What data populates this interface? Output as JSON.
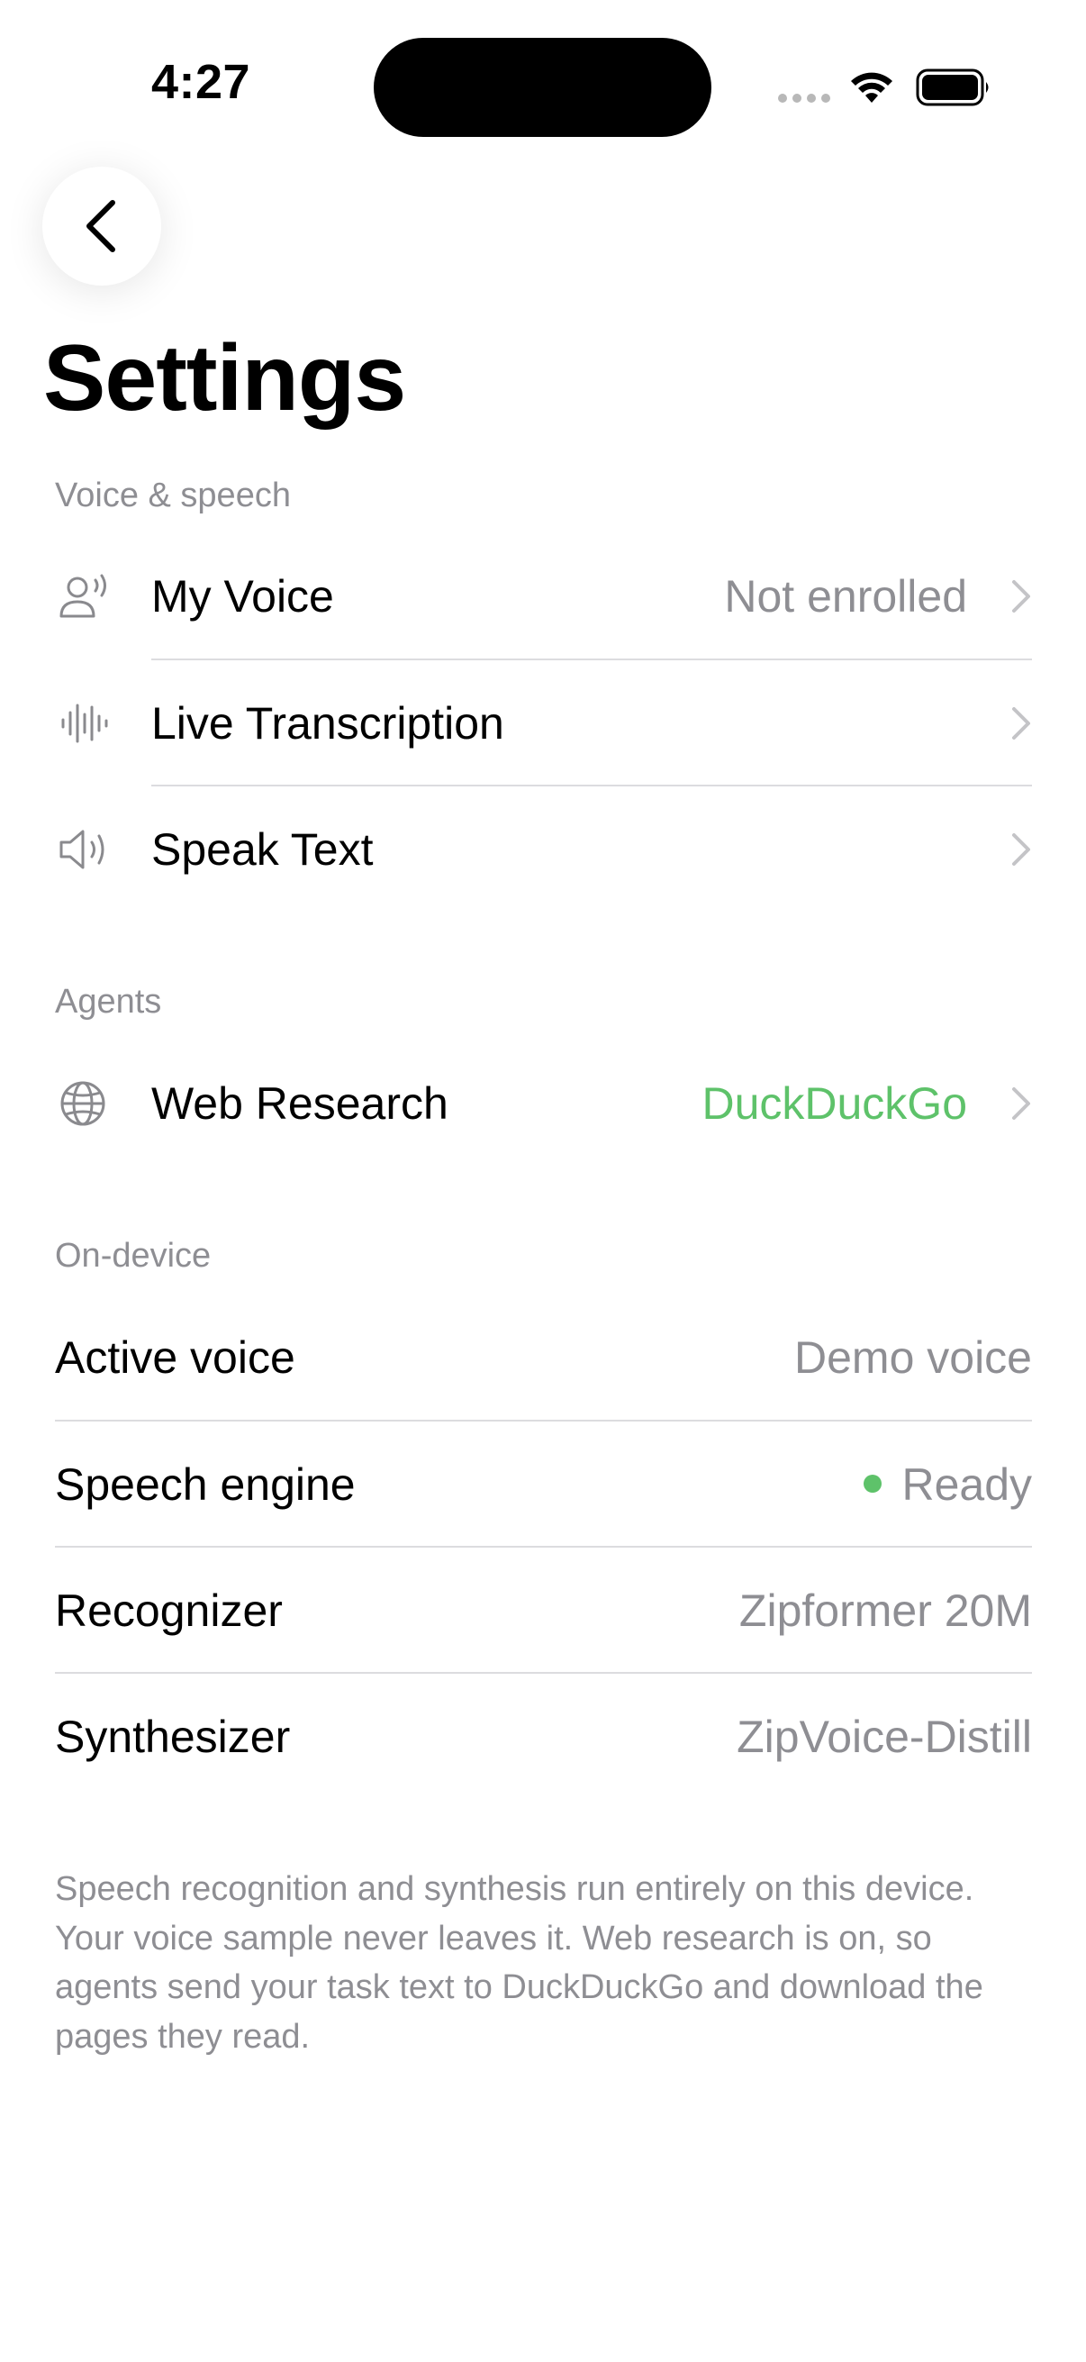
{
  "status_bar": {
    "time": "4:27"
  },
  "header": {
    "back_icon": "chevron-left-icon",
    "title": "Settings"
  },
  "sections": {
    "voice_speech": {
      "header": "Voice & speech",
      "rows": {
        "my_voice": {
          "label": "My Voice",
          "value": "Not enrolled",
          "icon": "person-speaking-icon"
        },
        "live_transcription": {
          "label": "Live Transcription",
          "icon": "waveform-icon"
        },
        "speak_text": {
          "label": "Speak Text",
          "icon": "speaker-icon"
        }
      }
    },
    "agents": {
      "header": "Agents",
      "rows": {
        "web_research": {
          "label": "Web Research",
          "value": "DuckDuckGo",
          "icon": "globe-icon"
        }
      }
    },
    "on_device": {
      "header": "On-device",
      "rows": {
        "active_voice": {
          "label": "Active voice",
          "value": "Demo voice"
        },
        "speech_engine": {
          "label": "Speech engine",
          "value": "Ready"
        },
        "recognizer": {
          "label": "Recognizer",
          "value": "Zipformer 20M"
        },
        "synthesizer": {
          "label": "Synthesizer",
          "value": "ZipVoice-Distill"
        }
      }
    }
  },
  "footer_note": "Speech recognition and synthesis run entirely on this device. Your voice sample never leaves it. Web research is on, so agents send your task text to DuckDuckGo and download the pages they read.",
  "colors": {
    "accent_green": "#5ec26a",
    "secondary_text": "#8e8e93",
    "divider": "#dcdcdf",
    "chevron": "#c4c4c7",
    "icon_gray": "#8a8a8e"
  }
}
